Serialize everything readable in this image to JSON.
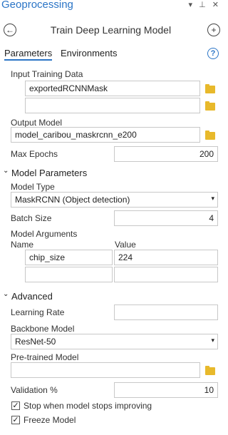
{
  "pane": {
    "title": "Geoprocessing",
    "controls": [
      "▾",
      "⊥",
      "✕"
    ]
  },
  "tool": {
    "title": "Train Deep Learning Model",
    "back_icon": "back-arrow-icon",
    "add_icon": "add-icon"
  },
  "tabs": [
    {
      "label": "Parameters",
      "active": true
    },
    {
      "label": "Environments",
      "active": false
    }
  ],
  "help": "?",
  "params": {
    "input_training_data": {
      "label": "Input Training Data",
      "values": [
        "exportedRCNNMask",
        ""
      ]
    },
    "output_model": {
      "label": "Output Model",
      "value": "model_caribou_maskrcnn_e200"
    },
    "max_epochs": {
      "label": "Max Epochs",
      "value": "200"
    }
  },
  "model_parameters": {
    "header": "Model Parameters",
    "model_type": {
      "label": "Model Type",
      "value": "MaskRCNN (Object detection)"
    },
    "batch_size": {
      "label": "Batch Size",
      "value": "4"
    },
    "model_arguments": {
      "label": "Model Arguments",
      "columns": [
        "Name",
        "Value"
      ],
      "rows": [
        {
          "name": "chip_size",
          "value": "224"
        },
        {
          "name": "",
          "value": ""
        }
      ]
    }
  },
  "advanced": {
    "header": "Advanced",
    "learning_rate": {
      "label": "Learning Rate",
      "value": ""
    },
    "backbone_model": {
      "label": "Backbone Model",
      "value": "ResNet-50"
    },
    "pretrained_model": {
      "label": "Pre-trained Model",
      "value": ""
    },
    "validation": {
      "label": "Validation %",
      "value": "10"
    },
    "stop_improving": {
      "label": "Stop when model stops improving",
      "checked": true
    },
    "freeze_model": {
      "label": "Freeze Model",
      "checked": true
    }
  },
  "colors": {
    "accent": "#2a74c6",
    "folder": "#e8b92b"
  }
}
